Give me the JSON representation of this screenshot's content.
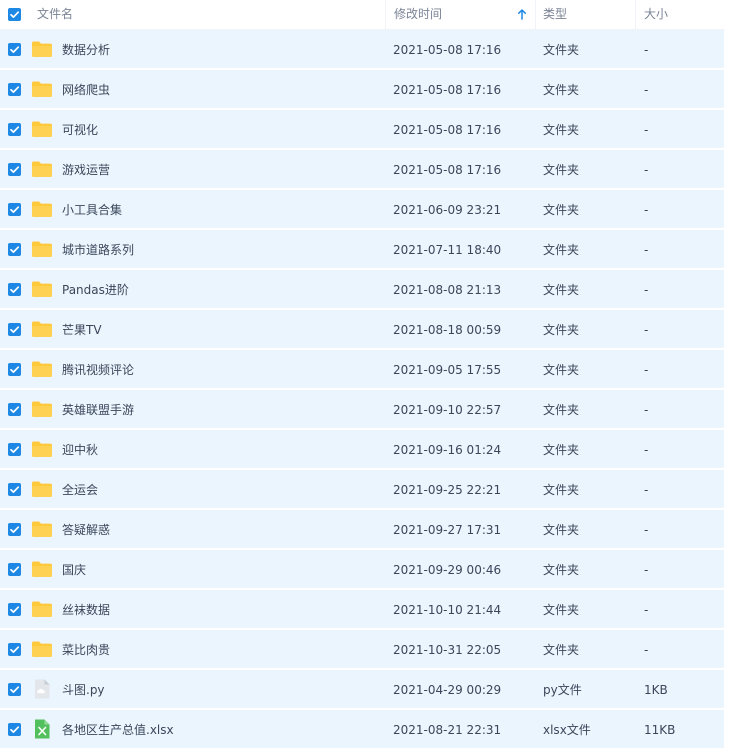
{
  "header": {
    "name_label": "文件名",
    "time_label": "修改时间",
    "type_label": "类型",
    "size_label": "大小",
    "sort_icon": "sort-ascending-arrow-icon",
    "sort_color": "#1e88e5"
  },
  "colors": {
    "accent": "#1e88e5",
    "row_selected_bg": "#eaf5fe",
    "folder": "#ffc93c",
    "excel": "#52c05c",
    "python": "#c8ccd3"
  },
  "rows": [
    {
      "name": "数据分析",
      "time": "2021-05-08 17:16",
      "type": "文件夹",
      "size": "-",
      "icon": "folder-icon"
    },
    {
      "name": "网络爬虫",
      "time": "2021-05-08 17:16",
      "type": "文件夹",
      "size": "-",
      "icon": "folder-icon"
    },
    {
      "name": "可视化",
      "time": "2021-05-08 17:16",
      "type": "文件夹",
      "size": "-",
      "icon": "folder-icon"
    },
    {
      "name": "游戏运营",
      "time": "2021-05-08 17:16",
      "type": "文件夹",
      "size": "-",
      "icon": "folder-icon"
    },
    {
      "name": "小工具合集",
      "time": "2021-06-09 23:21",
      "type": "文件夹",
      "size": "-",
      "icon": "folder-icon"
    },
    {
      "name": "城市道路系列",
      "time": "2021-07-11 18:40",
      "type": "文件夹",
      "size": "-",
      "icon": "folder-icon"
    },
    {
      "name": "Pandas进阶",
      "time": "2021-08-08 21:13",
      "type": "文件夹",
      "size": "-",
      "icon": "folder-icon"
    },
    {
      "name": "芒果TV",
      "time": "2021-08-18 00:59",
      "type": "文件夹",
      "size": "-",
      "icon": "folder-icon"
    },
    {
      "name": "腾讯视频评论",
      "time": "2021-09-05 17:55",
      "type": "文件夹",
      "size": "-",
      "icon": "folder-icon"
    },
    {
      "name": "英雄联盟手游",
      "time": "2021-09-10 22:57",
      "type": "文件夹",
      "size": "-",
      "icon": "folder-icon"
    },
    {
      "name": "迎中秋",
      "time": "2021-09-16 01:24",
      "type": "文件夹",
      "size": "-",
      "icon": "folder-icon"
    },
    {
      "name": "全运会",
      "time": "2021-09-25 22:21",
      "type": "文件夹",
      "size": "-",
      "icon": "folder-icon"
    },
    {
      "name": "答疑解惑",
      "time": "2021-09-27 17:31",
      "type": "文件夹",
      "size": "-",
      "icon": "folder-icon"
    },
    {
      "name": "国庆",
      "time": "2021-09-29 00:46",
      "type": "文件夹",
      "size": "-",
      "icon": "folder-icon"
    },
    {
      "name": "丝袜数据",
      "time": "2021-10-10 21:44",
      "type": "文件夹",
      "size": "-",
      "icon": "folder-icon"
    },
    {
      "name": "菜比肉贵",
      "time": "2021-10-31 22:05",
      "type": "文件夹",
      "size": "-",
      "icon": "folder-icon"
    },
    {
      "name": "斗图.py",
      "time": "2021-04-29 00:29",
      "type": "py文件",
      "size": "1KB",
      "icon": "python-file-icon"
    },
    {
      "name": "各地区生产总值.xlsx",
      "time": "2021-08-21 22:31",
      "type": "xlsx文件",
      "size": "11KB",
      "icon": "excel-file-icon"
    }
  ]
}
